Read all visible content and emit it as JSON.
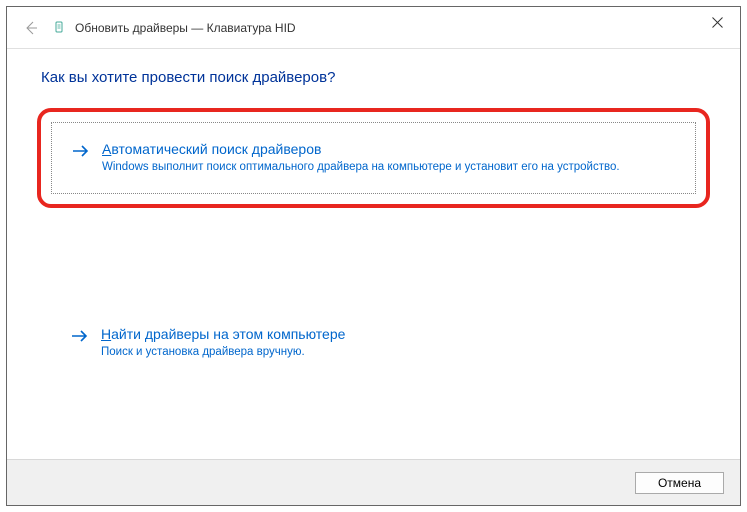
{
  "window": {
    "title": "Обновить драйверы — Клавиатура HID"
  },
  "heading": "Как вы хотите провести поиск драйверов?",
  "options": {
    "auto": {
      "title_first": "А",
      "title_rest": "втоматический поиск драйверов",
      "desc": "Windows выполнит поиск оптимального драйвера на компьютере и установит его на устройство."
    },
    "manual": {
      "title_first": "Н",
      "title_rest": "айти драйверы на этом компьютере",
      "desc": "Поиск и установка драйвера вручную."
    }
  },
  "buttons": {
    "cancel": "Отмена"
  }
}
